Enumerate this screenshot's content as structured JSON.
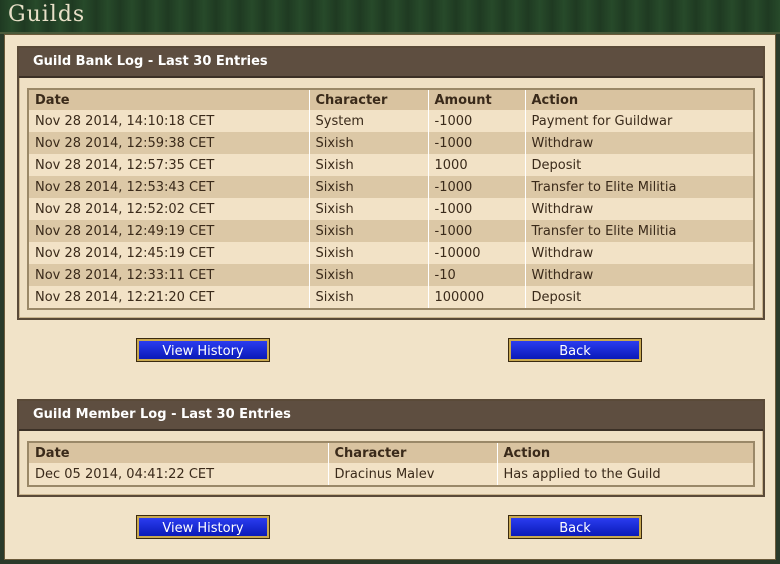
{
  "window": {
    "title": "Guilds"
  },
  "bank_log": {
    "title": "Guild Bank Log - Last 30 Entries",
    "columns": [
      "Date",
      "Character",
      "Amount",
      "Action"
    ],
    "rows": [
      [
        "Nov 28 2014, 14:10:18 CET",
        "System",
        "-1000",
        "Payment for Guildwar"
      ],
      [
        "Nov 28 2014, 12:59:38 CET",
        "Sixish",
        "-1000",
        "Withdraw"
      ],
      [
        "Nov 28 2014, 12:57:35 CET",
        "Sixish",
        "1000",
        "Deposit"
      ],
      [
        "Nov 28 2014, 12:53:43 CET",
        "Sixish",
        "-1000",
        "Transfer to Elite Militia"
      ],
      [
        "Nov 28 2014, 12:52:02 CET",
        "Sixish",
        "-1000",
        "Withdraw"
      ],
      [
        "Nov 28 2014, 12:49:19 CET",
        "Sixish",
        "-1000",
        "Transfer to Elite Militia"
      ],
      [
        "Nov 28 2014, 12:45:19 CET",
        "Sixish",
        "-10000",
        "Withdraw"
      ],
      [
        "Nov 28 2014, 12:33:11 CET",
        "Sixish",
        "-10",
        "Withdraw"
      ],
      [
        "Nov 28 2014, 12:21:20 CET",
        "Sixish",
        "100000",
        "Deposit"
      ]
    ],
    "view_history_label": "View History",
    "back_label": "Back"
  },
  "member_log": {
    "title": "Guild Member Log - Last 30 Entries",
    "columns": [
      "Date",
      "Character",
      "Action"
    ],
    "rows": [
      [
        "Dec 05 2014, 04:41:22 CET",
        "Dracinus Malev",
        "Has applied to the Guild"
      ]
    ],
    "view_history_label": "View History",
    "back_label": "Back"
  }
}
